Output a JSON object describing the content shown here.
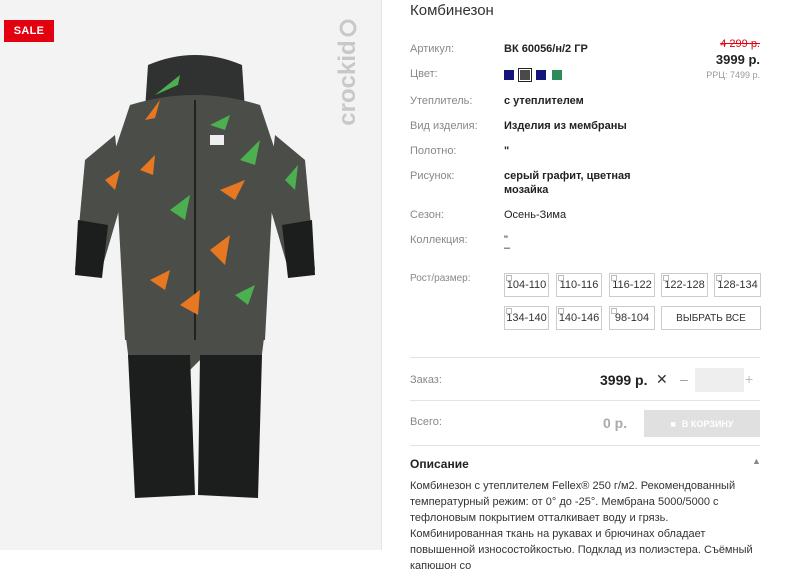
{
  "badge": {
    "sale": "SALE"
  },
  "brand": {
    "name": "crockid"
  },
  "product": {
    "title": "Комбинезон",
    "fields": [
      {
        "label": "Артикул:",
        "value": "ВК 60056/н/2 ГР"
      },
      {
        "label": "Цвет:",
        "value": ""
      },
      {
        "label": "Утеплитель:",
        "value": "с утеплителем"
      },
      {
        "label": "Вид изделия:",
        "value": "Изделия из мембраны"
      },
      {
        "label": "Полотно:",
        "value": "\""
      },
      {
        "label": "Рисунок:",
        "value": "серый графит, цветная",
        "value2": "мозайка"
      },
      {
        "label": "Сезон:",
        "value": "Осень-Зима"
      },
      {
        "label": "Коллекция:",
        "value": "\"",
        "value2": "–"
      }
    ],
    "colors": [
      "#14147a",
      "#4a4a4a",
      "#14147a",
      "#2e8b57"
    ],
    "price": {
      "old": "4 299 р.",
      "new": "3999 р.",
      "rrp": "РРЦ: 7499 р."
    }
  },
  "sizes": {
    "label": "Рост/размер:",
    "items": [
      "104-110",
      "110-116",
      "116-122",
      "122-128",
      "128-134",
      "134-140",
      "140-146",
      "98-104"
    ],
    "select_all": "ВЫБРАТЬ ВСЕ"
  },
  "order": {
    "label": "Заказ:",
    "price": "3999 р.",
    "remove": "✕",
    "minus": "–",
    "plus": "+",
    "qty": ""
  },
  "total": {
    "label": "Всего:",
    "value": "0 р.",
    "cart_button": "В КОРЗИНУ"
  },
  "description": {
    "title": "Описание",
    "text": "Комбинезон с утеплителем Fellex® 250 г/м2. Рекомендованный температурный режим: от 0° до -25°. Мембрана 5000/5000 с тефлоновым покрытием отталкивает воду и грязь. Комбинированная ткань на рукавах и брючинах обладает повышенной износостойкостью. Подклад из полиэстера. Съёмный капюшон со"
  }
}
